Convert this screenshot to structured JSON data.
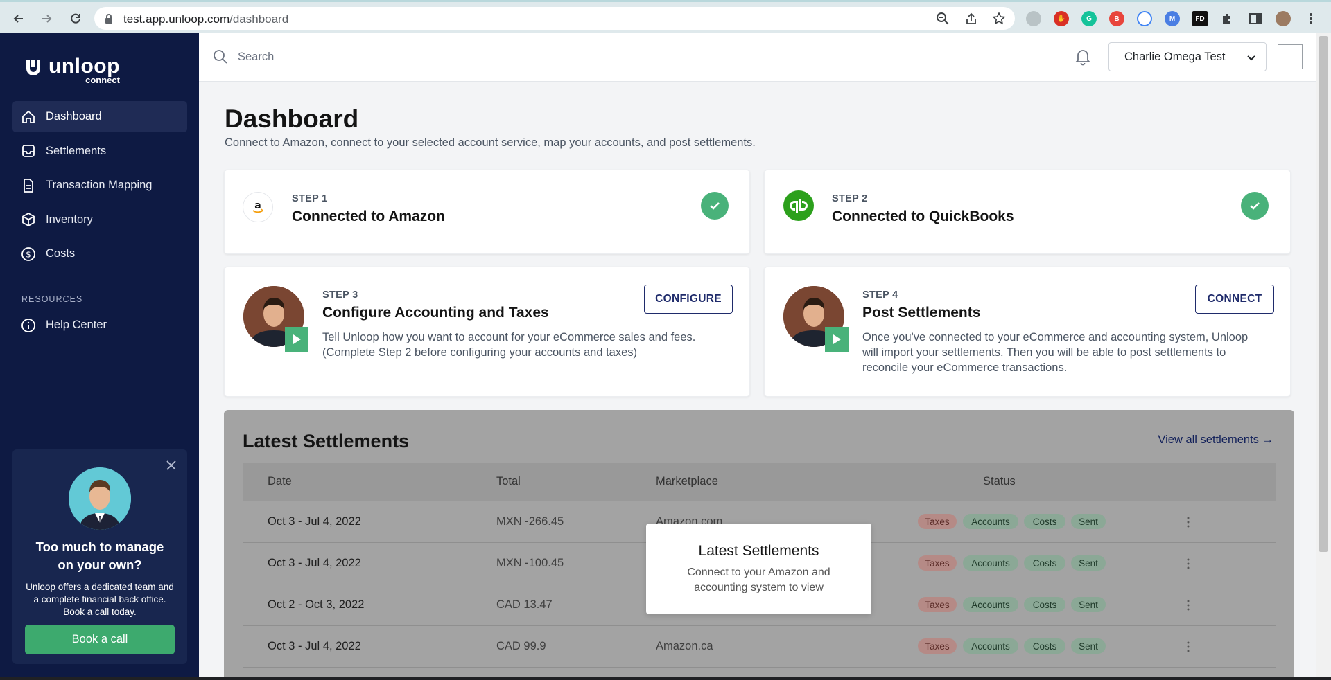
{
  "browser": {
    "url_host": "test.app.unloop.com",
    "url_path": "/dashboard"
  },
  "sidebar": {
    "brand": "unloop",
    "brand_sub": "connect",
    "items": [
      {
        "label": "Dashboard",
        "icon": "home-icon"
      },
      {
        "label": "Settlements",
        "icon": "inbox-icon"
      },
      {
        "label": "Transaction Mapping",
        "icon": "document-icon"
      },
      {
        "label": "Inventory",
        "icon": "box-icon"
      },
      {
        "label": "Costs",
        "icon": "dollar-circle-icon"
      }
    ],
    "resources_label": "RESOURCES",
    "help_label": "Help Center",
    "promo": {
      "title": "Too much to manage on your own?",
      "text": "Unloop offers a dedicated team and a complete financial back office. Book a call today.",
      "button": "Book a call"
    }
  },
  "topbar": {
    "search_placeholder": "Search",
    "user_name": "Charlie Omega Test"
  },
  "page": {
    "title": "Dashboard",
    "subtitle": "Connect to Amazon, connect to your selected account service, map your accounts, and post settlements."
  },
  "steps": [
    {
      "label": "STEP 1",
      "title": "Connected to Amazon"
    },
    {
      "label": "STEP 2",
      "title": "Connected to QuickBooks"
    },
    {
      "label": "STEP 3",
      "title": "Configure Accounting and Taxes",
      "desc": "Tell Unloop how you want to account for your eCommerce sales and fees. (Complete Step 2 before configuring your accounts and taxes)",
      "button": "CONFIGURE"
    },
    {
      "label": "STEP 4",
      "title": "Post Settlements",
      "desc": "Once you've connected to your eCommerce and accounting system, Unloop will import your settlements. Then you will be able to post settlements to reconcile your eCommerce transactions.",
      "button": "CONNECT"
    }
  ],
  "settlements": {
    "title": "Latest Settlements",
    "view_all": "View all settlements →",
    "columns": [
      "Date",
      "Total",
      "Marketplace",
      "Status"
    ],
    "rows": [
      {
        "date": "Oct 3 - Jul 4, 2022",
        "total": "MXN -266.45",
        "marketplace": "Amazon.com"
      },
      {
        "date": "Oct 3 - Jul 4, 2022",
        "total": "MXN -100.45",
        "marketplace": ""
      },
      {
        "date": "Oct 2 - Oct 3, 2022",
        "total": "CAD 13.47",
        "marketplace": ""
      },
      {
        "date": "Oct 3 - Jul 4, 2022",
        "total": "CAD 99.9",
        "marketplace": "Amazon.ca"
      }
    ],
    "badges": [
      "Taxes",
      "Accounts",
      "Costs",
      "Sent"
    ],
    "overlay_title": "Latest Settlements",
    "overlay_text": "Connect to your Amazon and accounting system to view"
  },
  "colors": {
    "sidebar_bg": "#0e1a43",
    "accent_green": "#49b27a",
    "navy": "#1f2b6b"
  }
}
